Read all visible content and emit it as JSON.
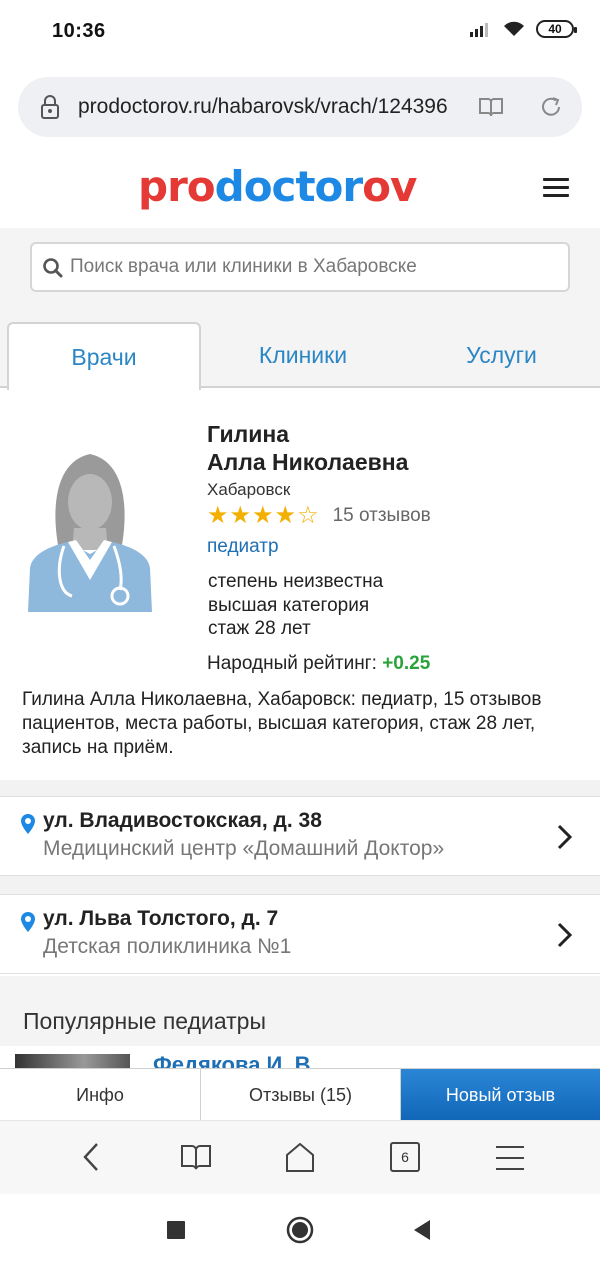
{
  "status": {
    "time": "10:36",
    "battery": "40"
  },
  "browser": {
    "url": "prodoctorov.ru/habarovsk/vrach/124396",
    "tab_count": "6"
  },
  "site": {
    "logo": {
      "part1": "pro",
      "part2": "doctor",
      "part3": "ov"
    },
    "search_placeholder": "Поиск врача или клиники в Хабаровске",
    "tabs": [
      {
        "label": "Врачи",
        "active": true
      },
      {
        "label": "Клиники",
        "active": false
      },
      {
        "label": "Услуги",
        "active": false
      }
    ]
  },
  "doctor": {
    "surname": "Гилина",
    "name": "Алла Николаевна",
    "city": "Хабаровск",
    "stars_filled": 4,
    "stars_total": 5,
    "reviews": "15 отзывов",
    "specialty": "педиатр",
    "degree": "степень неизвестна",
    "category": "высшая категория",
    "experience": "стаж 28 лет",
    "people_rating_label": "Народный рейтинг:",
    "people_rating_value": "+0.25",
    "description": "Гилина Алла Николаевна, Хабаровск: педиатр, 15 отзывов пациентов, места работы, высшая категория, стаж 28 лет, запись на приём."
  },
  "addresses": [
    {
      "street": "ул. Владивостокская, д. 38",
      "clinic": "Медицинский центр «Домашний Доктор»"
    },
    {
      "street": "ул. Льва Толстого, д. 7",
      "clinic": "Детская поликлиника №1"
    }
  ],
  "popular": {
    "title": "Популярные педиатры",
    "first_name": "Федякова И. В."
  },
  "site_tabbar": {
    "info": "Инфо",
    "reviews": "Отзывы (15)",
    "new_review": "Новый отзыв"
  },
  "colors": {
    "accent_blue": "#2b86c5",
    "logo_red": "#e53935",
    "logo_blue": "#1e88e5",
    "rating_green": "#2aa33a",
    "star": "#f4b000"
  }
}
